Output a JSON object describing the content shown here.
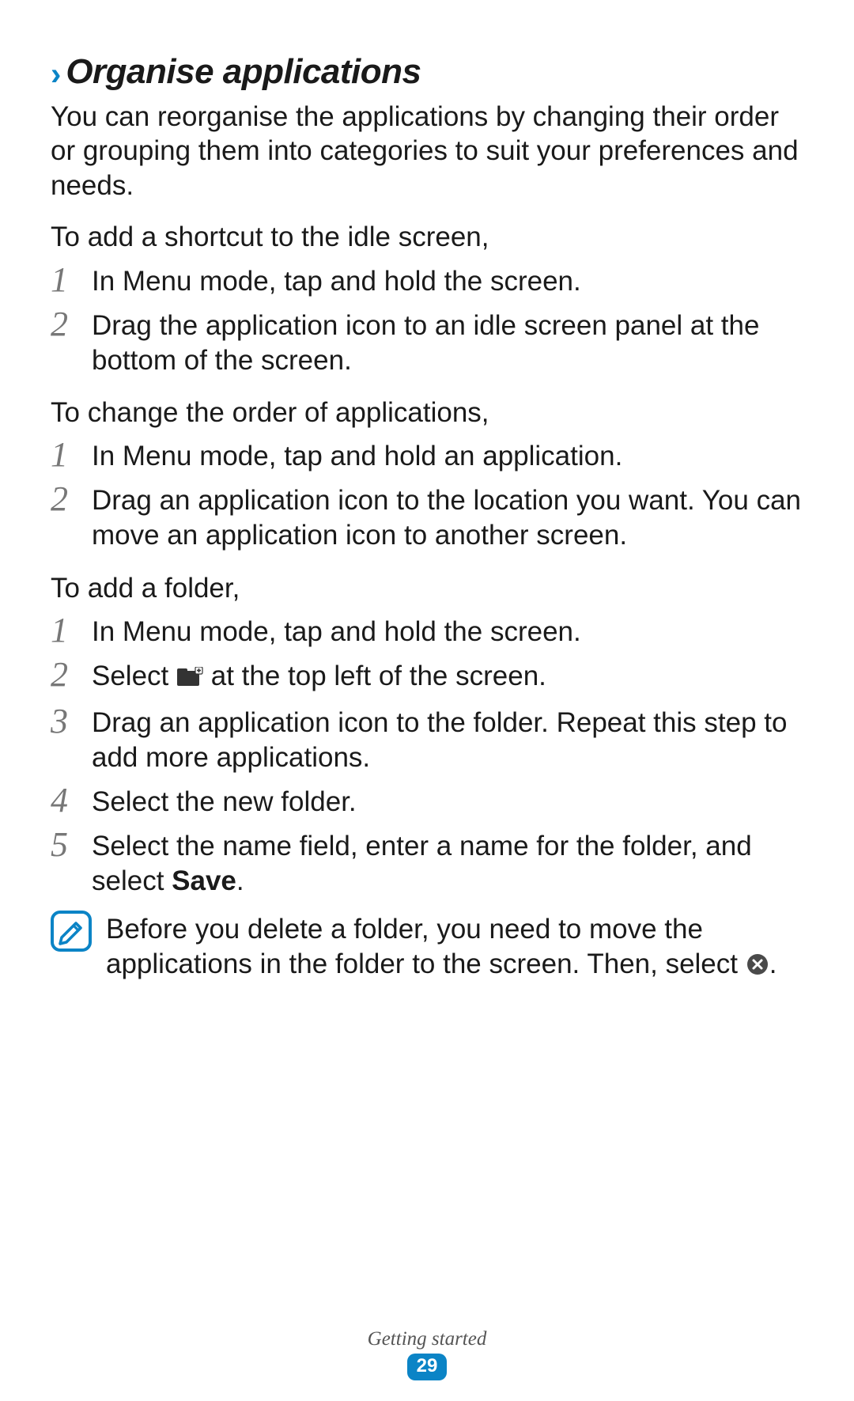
{
  "heading": {
    "title": "Organise applications"
  },
  "intro": "You can reorganise the applications by changing their order or grouping them into categories to suit your preferences and needs.",
  "section1": {
    "lead": "To add a shortcut to the idle screen,",
    "steps": [
      "In Menu mode, tap and hold the screen.",
      "Drag the application icon to an idle screen panel at the bottom of the screen."
    ]
  },
  "section2": {
    "lead": "To change the order of applications,",
    "steps": [
      "In Menu mode, tap and hold an application.",
      "Drag an application icon to the location you want. You can move an application icon to another screen."
    ]
  },
  "section3": {
    "lead": "To add a folder,",
    "step1": "In Menu mode, tap and hold the screen.",
    "step2_pre": "Select ",
    "step2_post": " at the top left of the screen.",
    "step3": "Drag an application icon to the folder. Repeat this step to add more applications.",
    "step4": "Select the new folder.",
    "step5_pre": "Select the name field, enter a name for the folder, and select ",
    "step5_bold": "Save",
    "step5_post": "."
  },
  "note": {
    "text_pre": "Before you delete a folder, you need to move the applications in the folder to the screen. Then, select ",
    "text_post": "."
  },
  "footer": {
    "section": "Getting started",
    "page": "29"
  },
  "nums": {
    "n1": "1",
    "n2": "2",
    "n3": "3",
    "n4": "4",
    "n5": "5"
  }
}
